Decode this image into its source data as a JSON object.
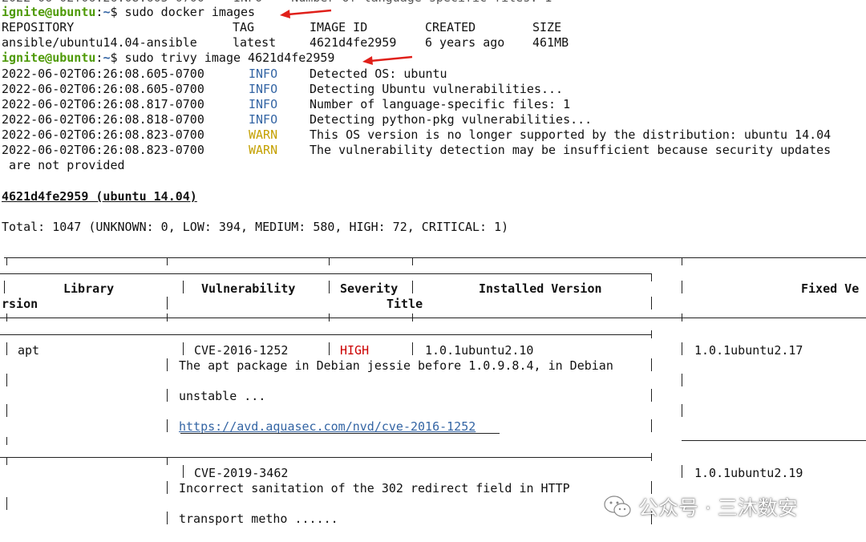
{
  "colors": {
    "prompt_user": "#4e9a06",
    "prompt_path": "#3465a4",
    "info": "#3465a4",
    "warn": "#c4a000",
    "high": "#cc0000",
    "arrow": "#e0201a"
  },
  "prompt": {
    "user_host": "ignite@ubuntu",
    "sep": ":",
    "path": "~",
    "dollar": "$ "
  },
  "commands": [
    "sudo docker images",
    "sudo trivy image 4621d4fe2959"
  ],
  "images_table": {
    "headers": [
      "REPOSITORY",
      "TAG",
      "IMAGE ID",
      "CREATED",
      "SIZE"
    ],
    "row": [
      "ansible/ubuntu14.04-ansible",
      "latest",
      "4621d4fe2959",
      "6 years ago",
      "461MB"
    ]
  },
  "logs": [
    {
      "time": "2022-06-02T06:26:08.605-0700",
      "level": "INFO",
      "msg": "Detected OS: ubuntu"
    },
    {
      "time": "2022-06-02T06:26:08.605-0700",
      "level": "INFO",
      "msg": "Detecting Ubuntu vulnerabilities..."
    },
    {
      "time": "2022-06-02T06:26:08.817-0700",
      "level": "INFO",
      "msg": "Number of language-specific files: 1"
    },
    {
      "time": "2022-06-02T06:26:08.818-0700",
      "level": "INFO",
      "msg": "Detecting python-pkg vulnerabilities..."
    },
    {
      "time": "2022-06-02T06:26:08.823-0700",
      "level": "WARN",
      "msg": "This OS version is no longer supported by the distribution: ubuntu 14.04"
    },
    {
      "time": "2022-06-02T06:26:08.823-0700",
      "level": "WARN",
      "msg": "The vulnerability detection may be insufficient because security updates"
    }
  ],
  "log_continuation": " are not provided",
  "target_title": "4621d4fe2959 (ubuntu 14.04)",
  "total_line": "Total: 1047 (UNKNOWN: 0, LOW: 394, MEDIUM: 580, HIGH: 72, CRITICAL: 1)",
  "vuln_table": {
    "headers": {
      "library": "Library",
      "vulnerability": "Vulnerability",
      "severity": "Severity",
      "installed": "Installed Version",
      "fixed": "Fixed Ve",
      "fixed_wrap": "rsion",
      "title": "Title"
    },
    "rows": [
      {
        "library": "apt",
        "cve": "CVE-2016-1252",
        "severity": "HIGH",
        "installed": "1.0.1ubuntu2.10",
        "fixed": "1.0.1ubuntu2.17",
        "title_1": "The apt package in Debian jessie before 1.0.9.8.4, in Debian",
        "title_2": "unstable ...",
        "url": "https://avd.aquasec.com/nvd/cve-2016-1252"
      },
      {
        "cve": "CVE-2019-3462",
        "fixed": "1.0.1ubuntu2.19",
        "title_1": "Incorrect sanitation of the 302 redirect field in HTTP",
        "title_2": "transport metho ......"
      }
    ]
  },
  "watermark": {
    "text": "公众号 · 三沐数安",
    "icon": "wechat-icon"
  }
}
